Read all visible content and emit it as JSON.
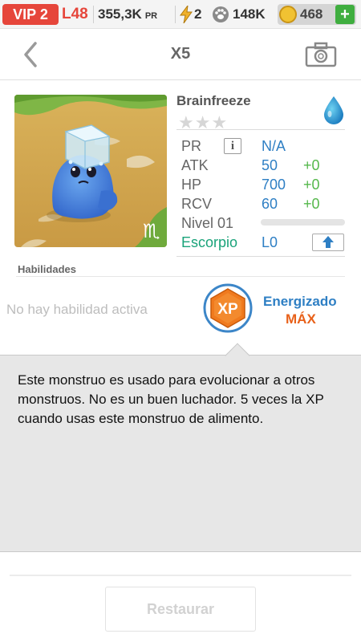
{
  "status_bar": {
    "vip_label": "VIP 2",
    "level": "L48",
    "pr_value": "355,3K",
    "pr_unit": "PR",
    "energy": "2",
    "paw_value": "148K",
    "coins": "468",
    "add_label": "+"
  },
  "header": {
    "title": "X5"
  },
  "monster": {
    "name": "Brainfreeze",
    "stars": "★★★",
    "element_icon": "water-drop-icon",
    "zodiac_glyph": "♏",
    "stats": {
      "pr_label": "PR",
      "pr_info": "i",
      "pr_value": "N/A",
      "atk_label": "ATK",
      "atk_value": "50",
      "atk_plus": "+0",
      "hp_label": "HP",
      "hp_value": "700",
      "hp_plus": "+0",
      "rcv_label": "RCV",
      "rcv_value": "60",
      "rcv_plus": "+0",
      "level_label": "Nivel 01",
      "level_progress": 0,
      "sign_label": "Escorpio",
      "sign_level": "L0"
    }
  },
  "skills": {
    "title": "Habilidades",
    "empty_text": "No hay habilidad activa",
    "xp_badge": "XP",
    "energized_label": "Energizado",
    "energized_value": "MÁX"
  },
  "description": "Este monstruo es usado para evolucionar a otros monstruos. No es un buen luchador. 5 veces la XP cuando usas este monstruo de alimento.",
  "restore_button": "Restaurar",
  "colors": {
    "accent_red": "#e6463b",
    "stat_blue": "#2e7fc4",
    "plus_green": "#55b84b",
    "zodiac_teal": "#1aa37a",
    "max_orange": "#e8611a"
  }
}
